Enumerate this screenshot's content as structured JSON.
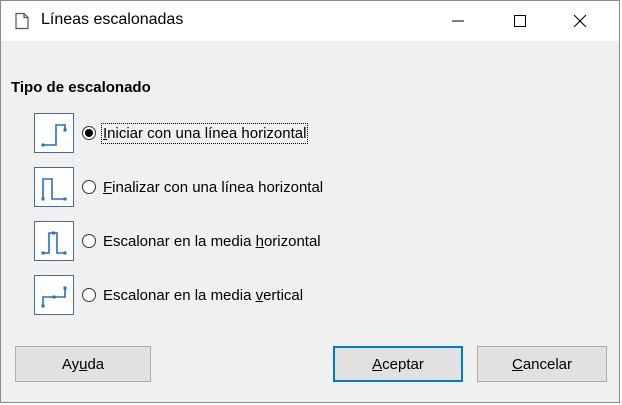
{
  "window": {
    "title": "Líneas escalonadas",
    "title_icon": "document-icon",
    "controls": [
      "minimize",
      "maximize",
      "close"
    ]
  },
  "section": {
    "title": "Tipo de escalonado"
  },
  "options": [
    {
      "icon": "step-start-horizontal-icon",
      "pre": "",
      "mnemonic": "I",
      "post": "niciar con una línea horizontal",
      "selected": true
    },
    {
      "icon": "step-end-horizontal-icon",
      "pre": "",
      "mnemonic": "F",
      "post": "inalizar con una línea horizontal",
      "selected": false
    },
    {
      "icon": "step-center-horizontal-icon",
      "pre": "Escalonar en la media ",
      "mnemonic": "h",
      "post": "orizontal",
      "selected": false
    },
    {
      "icon": "step-center-vertical-icon",
      "pre": "Escalonar en la media ",
      "mnemonic": "v",
      "post": "ertical",
      "selected": false
    }
  ],
  "buttons": {
    "help": {
      "pre": "Ay",
      "mnemonic": "u",
      "post": "da"
    },
    "ok": {
      "pre": "",
      "mnemonic": "A",
      "post": "ceptar"
    },
    "cancel": {
      "pre": "",
      "mnemonic": "C",
      "post": "ancelar"
    }
  },
  "colors": {
    "accent": "#0078d7",
    "icon_border": "#4d6d8c",
    "icon_line": "#2a6ebb"
  }
}
